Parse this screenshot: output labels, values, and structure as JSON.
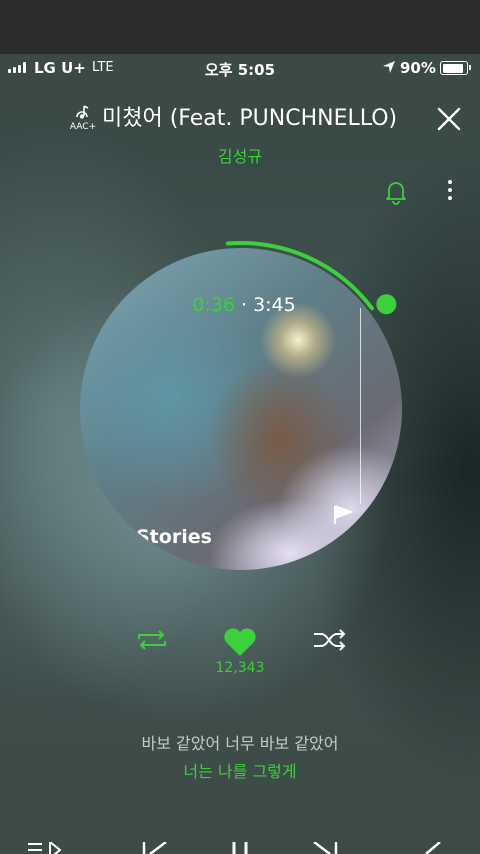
{
  "status_bar": {
    "carrier": "LG U+",
    "network": "LTE",
    "time": "오후 5:05",
    "battery": "90%",
    "battery_level": 0.9
  },
  "header": {
    "format_badge": "AAC+",
    "title": "미쳤어 (Feat. PUNCHNELLO)",
    "artist": "김성규"
  },
  "player": {
    "elapsed": "0:36",
    "separator": "·",
    "duration": "3:45",
    "progress_fraction": 0.16,
    "album_text": "Stories"
  },
  "controls": {
    "likes": "12,343"
  },
  "lyrics": {
    "current": "바보 같았어 너무 바보 같았어",
    "next": "너는 나를 그렇게"
  },
  "colors": {
    "accent": "#3cd03c",
    "text": "#ffffff"
  },
  "icons": [
    "aac-icon",
    "close-icon",
    "bell-icon",
    "more-icon",
    "repeat-icon",
    "heart-icon",
    "shuffle-icon",
    "playlist-icon",
    "previous-icon",
    "pause-icon",
    "next-icon",
    "share-icon"
  ]
}
